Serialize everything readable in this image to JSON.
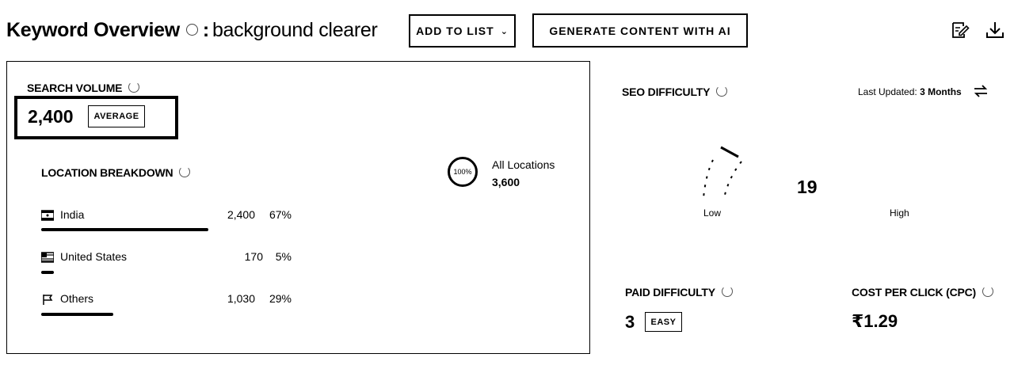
{
  "header": {
    "title_prefix": "Keyword Overview",
    "title_colon": ":",
    "keyword": "background clearer",
    "add_to_list_label": "ADD TO LIST",
    "generate_label": "GENERATE CONTENT WITH AI",
    "icons": [
      "edit-report-icon",
      "download-icon"
    ]
  },
  "search_volume": {
    "label": "SEARCH VOLUME",
    "value": "2,400",
    "badge": "AVERAGE"
  },
  "location_breakdown": {
    "label": "LOCATION BREAKDOWN",
    "rows": [
      {
        "name": "India",
        "count": "2,400",
        "pct": "67%",
        "fraction": 0.67,
        "icon": "india-flag-icon"
      },
      {
        "name": "United States",
        "count": "170",
        "pct": "5%",
        "fraction": 0.05,
        "icon": "us-flag-icon"
      },
      {
        "name": "Others",
        "count": "1,030",
        "pct": "29%",
        "fraction": 0.29,
        "icon": "flag-outline-icon"
      }
    ],
    "all_locations_pct": "100%",
    "all_locations_label": "All Locations",
    "all_locations_count": "3,600"
  },
  "seo_difficulty": {
    "label": "SEO DIFFICULTY",
    "last_updated_prefix": "Last Updated:",
    "last_updated_value": "3 Months",
    "value": "19",
    "low_label": "Low",
    "high_label": "High"
  },
  "paid_difficulty": {
    "label": "PAID DIFFICULTY",
    "value": "3",
    "badge": "EASY"
  },
  "cpc": {
    "label": "COST PER CLICK (CPC)",
    "value": "₹1.29"
  }
}
